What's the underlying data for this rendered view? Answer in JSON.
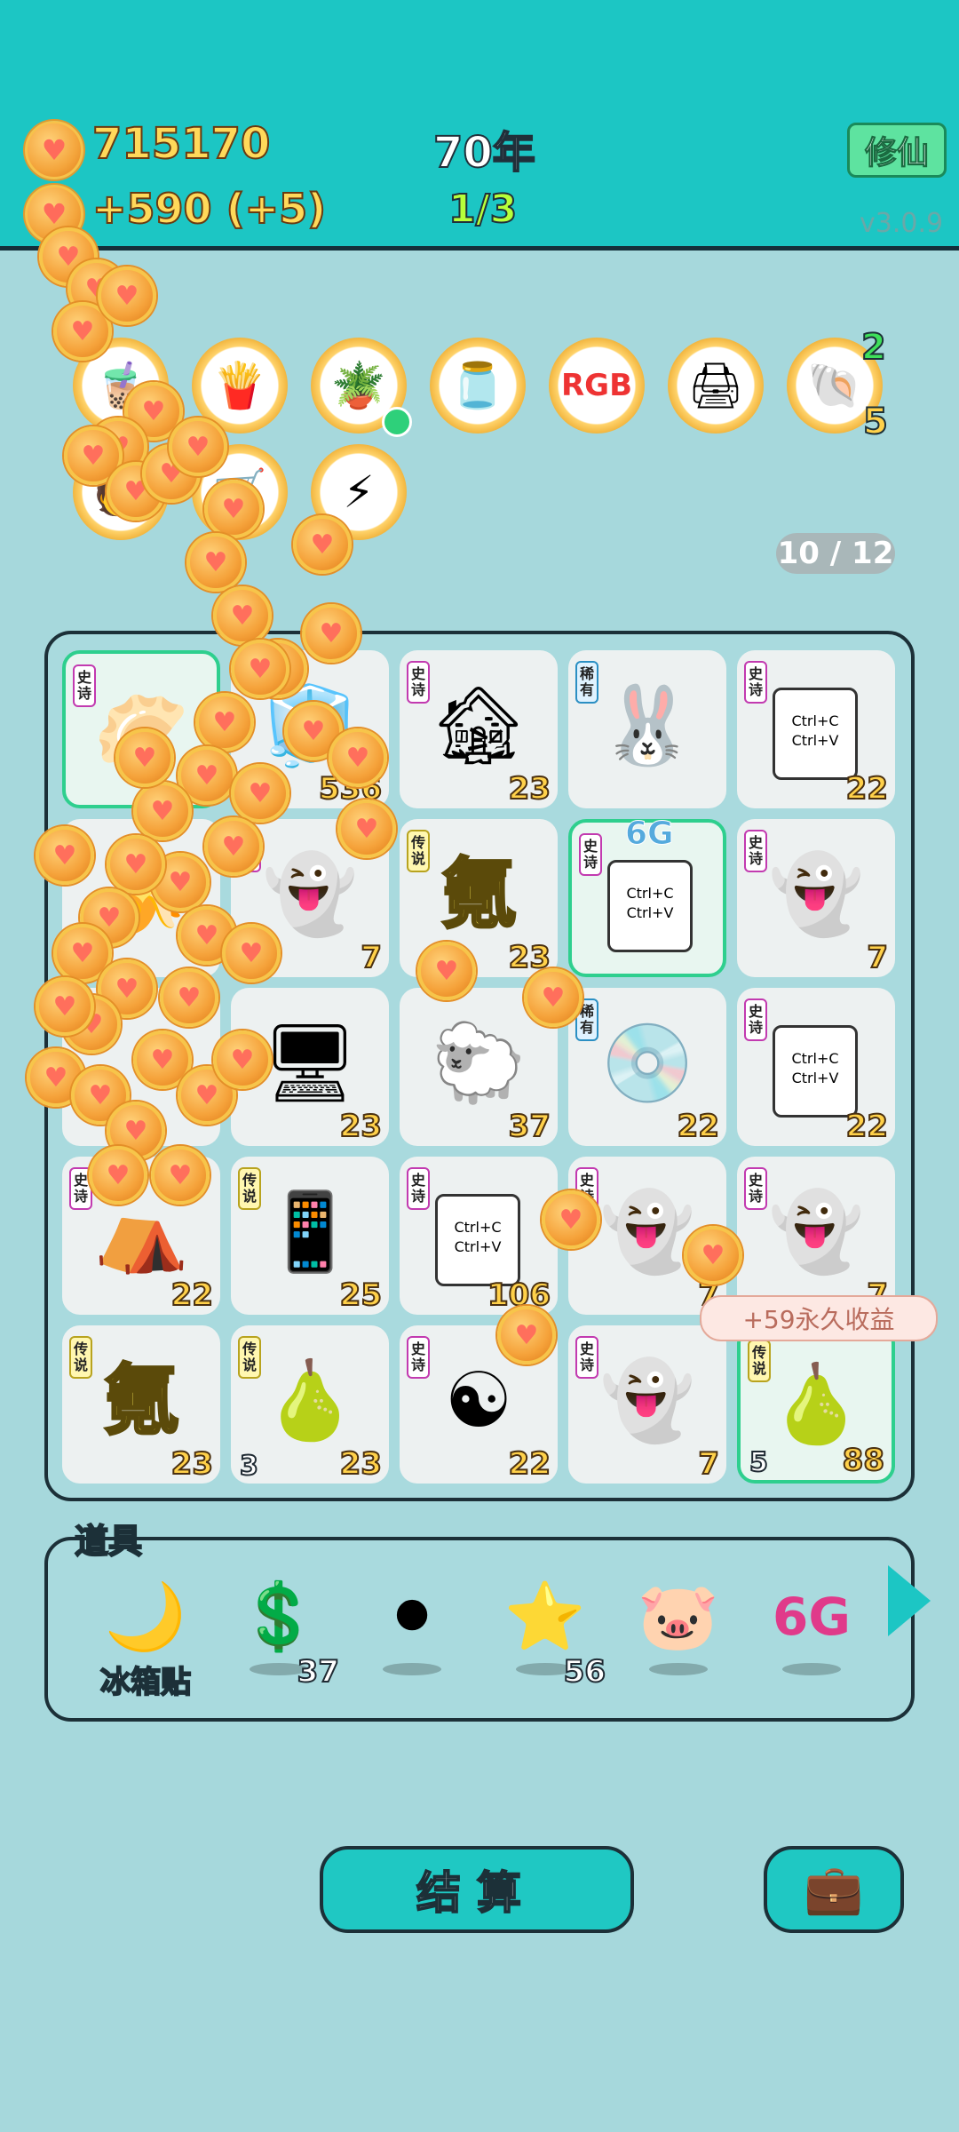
{
  "header": {
    "coins": "715170",
    "income": "+590 (+5)",
    "year": "70年",
    "progress": "1/3",
    "mode_button": "修仙",
    "version": "v3.0.9"
  },
  "badges": {
    "shell_count_top": "2",
    "shell_count_bottom": "5"
  },
  "level_counter": "10 / 12",
  "grid": [
    {
      "tag": "史诗",
      "tag_type": "shi",
      "icon": "dumpling-icon",
      "glyph": "🥟",
      "count": "",
      "hl": true
    },
    {
      "tag": "",
      "tag_type": "",
      "icon": "fridge-icon",
      "glyph": "🧊",
      "count": "536",
      "hl": false
    },
    {
      "tag": "史诗",
      "tag_type": "shi",
      "icon": "house-icon",
      "glyph": "🏚",
      "count": "23",
      "hl": false
    },
    {
      "tag": "稀有",
      "tag_type": "xi",
      "icon": "rabbit-icon",
      "glyph": "🐰",
      "count": "",
      "hl": false
    },
    {
      "tag": "史诗",
      "tag_type": "shi",
      "icon": "copy-paste-icon",
      "glyph": "",
      "ctrl": "Ctrl+C\nCtrl+V",
      "count": "22",
      "hl": false
    },
    {
      "tag": "",
      "tag_type": "",
      "icon": "banana-icon",
      "glyph": "🍌",
      "count": "",
      "hl": false
    },
    {
      "tag": "史诗",
      "tag_type": "shi",
      "icon": "ghost-icon",
      "glyph": "👻",
      "count": "7",
      "hl": false
    },
    {
      "tag": "传说",
      "tag_type": "chuan",
      "icon": "qi-icon",
      "glyph": "",
      "qi": "氪",
      "count": "23",
      "hl": false
    },
    {
      "tag": "史诗",
      "tag_type": "shi",
      "icon": "copy-paste-crown-icon",
      "glyph": "",
      "ctrl": "Ctrl+C\nCtrl+V",
      "count": "",
      "hl": true,
      "top": "6G"
    },
    {
      "tag": "史诗",
      "tag_type": "shi",
      "icon": "ghost-icon",
      "glyph": "👻",
      "count": "7",
      "hl": false
    },
    {
      "tag": "",
      "tag_type": "",
      "icon": "coin-pile-icon",
      "glyph": "",
      "count": "",
      "hl": false
    },
    {
      "tag": "",
      "tag_type": "",
      "icon": "gpu-icon",
      "glyph": "🖥",
      "count": "23",
      "hl": false
    },
    {
      "tag": "",
      "tag_type": "",
      "icon": "sheep-icon",
      "glyph": "🐑",
      "count": "37",
      "hl": false
    },
    {
      "tag": "稀有",
      "tag_type": "xi",
      "icon": "disc-icon",
      "glyph": "💿",
      "count": "22",
      "hl": false
    },
    {
      "tag": "史诗",
      "tag_type": "shi",
      "icon": "copy-paste-icon",
      "glyph": "",
      "ctrl": "Ctrl+C\nCtrl+V",
      "count": "22",
      "hl": false
    },
    {
      "tag": "史诗",
      "tag_type": "shi",
      "icon": "tent-rabbit-icon",
      "glyph": "⛺",
      "count": "22",
      "hl": false
    },
    {
      "tag": "传说",
      "tag_type": "chuan",
      "icon": "phone-icon",
      "glyph": "📱",
      "count": "25",
      "hl": false
    },
    {
      "tag": "史诗",
      "tag_type": "shi",
      "icon": "copy-paste-icon",
      "glyph": "",
      "ctrl": "Ctrl+C\nCtrl+V",
      "count": "106",
      "hl": false
    },
    {
      "tag": "史诗",
      "tag_type": "shi",
      "icon": "ghost-icon",
      "glyph": "👻",
      "count": "7",
      "hl": false
    },
    {
      "tag": "史诗",
      "tag_type": "shi",
      "icon": "ghost-icon",
      "glyph": "👻",
      "count": "7",
      "hl": false
    },
    {
      "tag": "传说",
      "tag_type": "chuan",
      "icon": "qi-icon",
      "glyph": "",
      "qi": "氪",
      "count": "23",
      "hl": false
    },
    {
      "tag": "传说",
      "tag_type": "chuan",
      "icon": "pear-icon",
      "glyph": "🍐",
      "count": "23",
      "lv": "3",
      "hl": false
    },
    {
      "tag": "史诗",
      "tag_type": "shi",
      "icon": "bagua-watermelon-icon",
      "glyph": "☯",
      "count": "22",
      "hl": false
    },
    {
      "tag": "史诗",
      "tag_type": "shi",
      "icon": "ghost-icon",
      "glyph": "👻",
      "count": "7",
      "hl": false
    },
    {
      "tag": "传说",
      "tag_type": "chuan",
      "icon": "pear-icon",
      "glyph": "🍐",
      "count": "88",
      "lv": "5",
      "hl": true
    }
  ],
  "tooltip": "+59永久收益",
  "props": {
    "title": "道具",
    "items": [
      {
        "icon": "moon-rabbit-icon",
        "glyph": "🌙",
        "label": "冰箱贴",
        "count": ""
      },
      {
        "icon": "dollar-coin-icon",
        "glyph": "💲",
        "label": "",
        "count": "37"
      },
      {
        "icon": "black-hole-icon",
        "glyph": "⚫",
        "label": "",
        "count": ""
      },
      {
        "icon": "star-icon",
        "glyph": "⭐",
        "label": "",
        "count": "56"
      },
      {
        "icon": "piggy-bank-icon",
        "glyph": "🐷",
        "label": "",
        "count": ""
      },
      {
        "icon": "6g-icon",
        "glyph": "6G",
        "label": "",
        "count": ""
      }
    ]
  },
  "buttons": {
    "settle": "结算"
  },
  "colors": {
    "header_bg": "#1cc6c4",
    "page_bg": "#a6d8dc",
    "coin_text": "#ffd95a",
    "ratio_text": "#b7ff3a"
  }
}
